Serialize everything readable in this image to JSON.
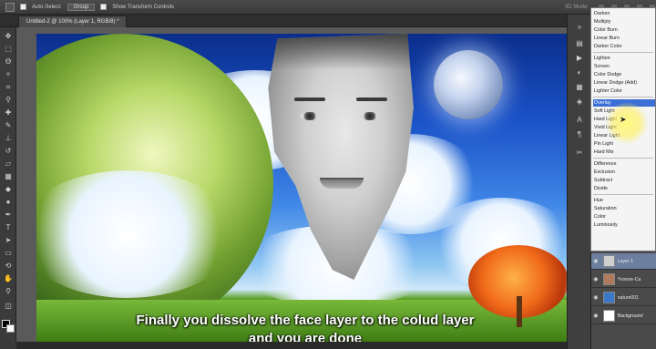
{
  "options_bar": {
    "auto_select_label": "Auto-Select:",
    "auto_select_value": "Group",
    "transform_label": "Show Transform Controls",
    "mode_3d_label": "3D Mode:"
  },
  "document": {
    "tab_title": "Untitled-2 @ 100% (Layer 1, RGB/8) *"
  },
  "caption": {
    "line1": "Finally you dissolve the face layer to the colud layer",
    "line2": "and you are done"
  },
  "blend_menu": {
    "groups": [
      [
        "Darken",
        "Multiply",
        "Color Burn",
        "Linear Burn",
        "Darker Color"
      ],
      [
        "Lighten",
        "Screen",
        "Color Dodge",
        "Linear Dodge (Add)",
        "Lighter Color"
      ],
      [
        "Overlay",
        "Soft Light",
        "Hard Light",
        "Vivid Light",
        "Linear Light",
        "Pin Light",
        "Hard Mix"
      ],
      [
        "Difference",
        "Exclusion",
        "Subtract",
        "Divide"
      ],
      [
        "Hue",
        "Saturation",
        "Color",
        "Luminosity"
      ]
    ],
    "selected": "Overlay"
  },
  "layers": [
    {
      "name": "Layer 1",
      "selected": true
    },
    {
      "name": "Yvonne-Ca",
      "selected": false
    },
    {
      "name": "nature001",
      "selected": false
    },
    {
      "name": "Background",
      "selected": false
    }
  ],
  "colors": {
    "menu_highlight": "#3b6fd6",
    "layer_selected": "#6c7f9e",
    "panel_bg": "#3a3a3a"
  }
}
